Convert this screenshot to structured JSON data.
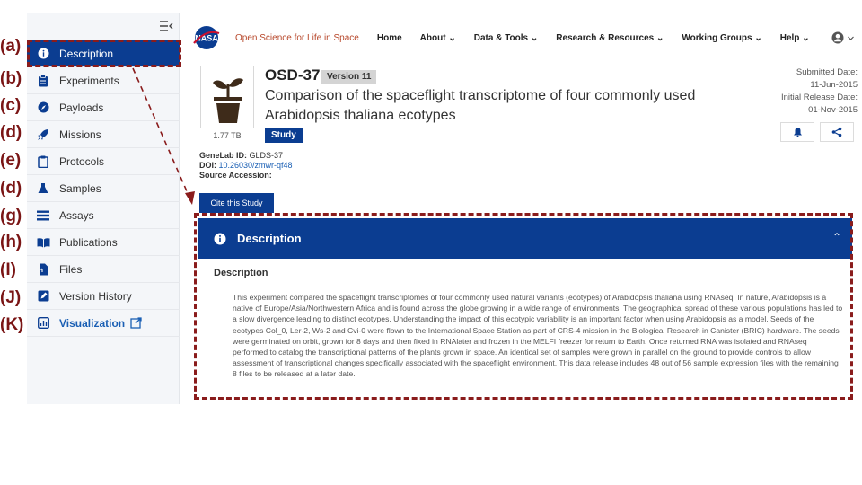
{
  "annotations": [
    "(a)",
    "(b)",
    "(c)",
    "(d)",
    "(e)",
    "(d)",
    "(g)",
    "(h)",
    "(I)",
    "(J)",
    "(K)"
  ],
  "sidebar": {
    "items": [
      {
        "label": "Description",
        "icon": "info-icon"
      },
      {
        "label": "Experiments",
        "icon": "clipboard-icon"
      },
      {
        "label": "Payloads",
        "icon": "compass-icon"
      },
      {
        "label": "Missions",
        "icon": "rocket-icon"
      },
      {
        "label": "Protocols",
        "icon": "clipboard-outline-icon"
      },
      {
        "label": "Samples",
        "icon": "flask-icon"
      },
      {
        "label": "Assays",
        "icon": "list-icon"
      },
      {
        "label": "Publications",
        "icon": "book-icon"
      },
      {
        "label": "Files",
        "icon": "file-icon"
      },
      {
        "label": "Version History",
        "icon": "edit-icon"
      },
      {
        "label": "Visualization",
        "icon": "chart-icon",
        "suffix_icon": "external-link-icon"
      }
    ]
  },
  "header": {
    "site_title": "Open Science for Life in Space",
    "nav": [
      {
        "label": "Home",
        "caret": false
      },
      {
        "label": "About",
        "caret": true
      },
      {
        "label": "Data & Tools",
        "caret": true
      },
      {
        "label": "Research & Resources",
        "caret": true
      },
      {
        "label": "Working Groups",
        "caret": true
      },
      {
        "label": "Help",
        "caret": true
      }
    ]
  },
  "dataset": {
    "id": "OSD-37",
    "version": "Version 11",
    "title": "Comparison of the spaceflight transcriptome of four commonly used Arabidopsis thaliana ecotypes",
    "type_badge": "Study",
    "size": "1.77 TB",
    "submitted_label": "Submitted Date:",
    "submitted_date": "11-Jun-2015",
    "release_label": "Initial Release Date:",
    "release_date": "01-Nov-2015",
    "genelab_label": "GeneLab ID:",
    "genelab_id": "GLDS-37",
    "doi_label": "DOI:",
    "doi": "10.26030/zmwr-qf48",
    "source_label": "Source Accession:",
    "cite_label": "Cite this Study"
  },
  "description": {
    "header": "Description",
    "subheading": "Description",
    "body": "This experiment compared the spaceflight transcriptomes of four commonly used natural variants (ecotypes) of Arabidopsis thaliana using RNAseq. In nature, Arabidopsis is a native of Europe/Asia/Northwestern Africa and is found across the globe growing in a wide range of environments. The geographical spread of these various populations has led to a slow divergence leading to distinct ecotypes. Understanding the impact of this ecotypic variability is an important factor when using Arabidopsis as a model. Seeds of the ecotypes Col_0, Ler-2, Ws-2 and Cvi-0 were flown to the International Space Station as part of CRS-4 mission in the Biological Research in Canister (BRIC) hardware. The seeds were germinated on orbit, grown for 8 days and then fixed in RNAlater and frozen in the MELFI freezer for return to Earth. Once returned RNA was isolated and RNAseq performed to catalog the transcriptional patterns of the plants grown in space. An identical set of samples were grown in parallel on the ground to provide controls to allow assessment of transcriptional changes specifically associated with the spaceflight environment. This data release includes 48 out of 56 sample expression files with the remaining 8 files to be released at a later date."
  },
  "colors": {
    "nasa_blue": "#0b3d91",
    "annotation": "#8a1c1c",
    "link": "#1a5fb4",
    "site_title": "#b7472a"
  }
}
